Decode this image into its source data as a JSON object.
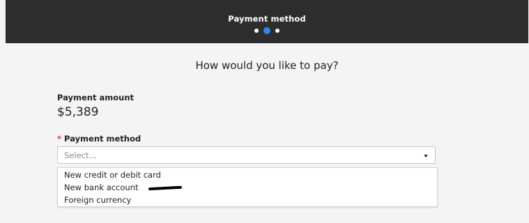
{
  "header": {
    "title": "Payment method",
    "steps": [
      {
        "state": "inactive"
      },
      {
        "state": "active"
      },
      {
        "state": "inactive"
      }
    ]
  },
  "main": {
    "question": "How would you like to pay?",
    "payment_amount": {
      "label": "Payment amount",
      "value": "$5,389"
    },
    "payment_method": {
      "required_marker": "*",
      "label": "Payment method",
      "placeholder": "Select...",
      "options": [
        "New credit or debit card",
        "New bank account",
        "Foreign currency"
      ]
    }
  },
  "colors": {
    "header_bg": "#2d2d2d",
    "active_step": "#2f86e8",
    "required": "#d63a3a",
    "page_bg": "#f4f4f4"
  }
}
